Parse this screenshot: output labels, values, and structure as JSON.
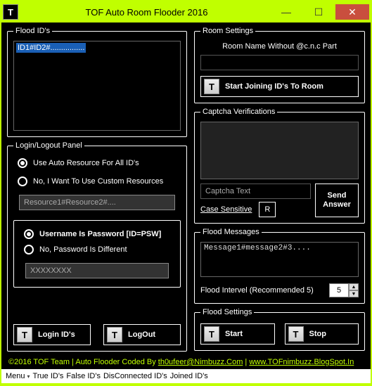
{
  "window": {
    "title": "TOF Auto Room Flooder 2016",
    "icon_letter": "T"
  },
  "flood_ids": {
    "legend": "Flood ID's",
    "content": "ID1#ID2#................"
  },
  "login_panel": {
    "legend": "Login/Logout Panel",
    "auto_resource_label": "Use Auto Resource For All ID's",
    "custom_resource_label": "No, I Want To Use Custom Resources",
    "resource_placeholder": "Resource1#Resource2#....",
    "username_is_password_label": "Username Is Password [ID=PSW]",
    "password_different_label": "No, Password Is Different",
    "password_placeholder": "XXXXXXXX",
    "login_btn": "Login ID's",
    "logout_btn": "LogOut"
  },
  "room": {
    "legend": "Room Settings",
    "label": "Room Name Without @c.n.c Part",
    "join_btn": "Start Joining ID's To Room"
  },
  "captcha": {
    "legend": "Captcha Verifications",
    "text_label": "Captcha Text",
    "case_sensitive": "Case Sensitive",
    "refresh": "R",
    "send": "Send Answer"
  },
  "messages": {
    "legend": "Flood Messages",
    "sample": "Message1#message2#3....",
    "interval_label": "Flood Intervel (Recommended 5)",
    "interval_value": "5"
  },
  "settings": {
    "legend": "Flood Settings",
    "start": "Start",
    "stop": "Stop"
  },
  "footer": {
    "copyright": "©2016 TOF Team",
    "credits_prefix": " | Auto Flooder Coded By ",
    "email": "th0ufeer@Nimbuzz.Com",
    "sep": " | ",
    "url": "www.TOFnimbuzz.BlogSpot.In"
  },
  "menu": {
    "menu": "Menu",
    "true_ids": "True ID's",
    "false_ids": "False ID's",
    "disconnected": "DisConnected ID's",
    "joined": "Joined ID's"
  },
  "icons": {
    "t": "T"
  }
}
